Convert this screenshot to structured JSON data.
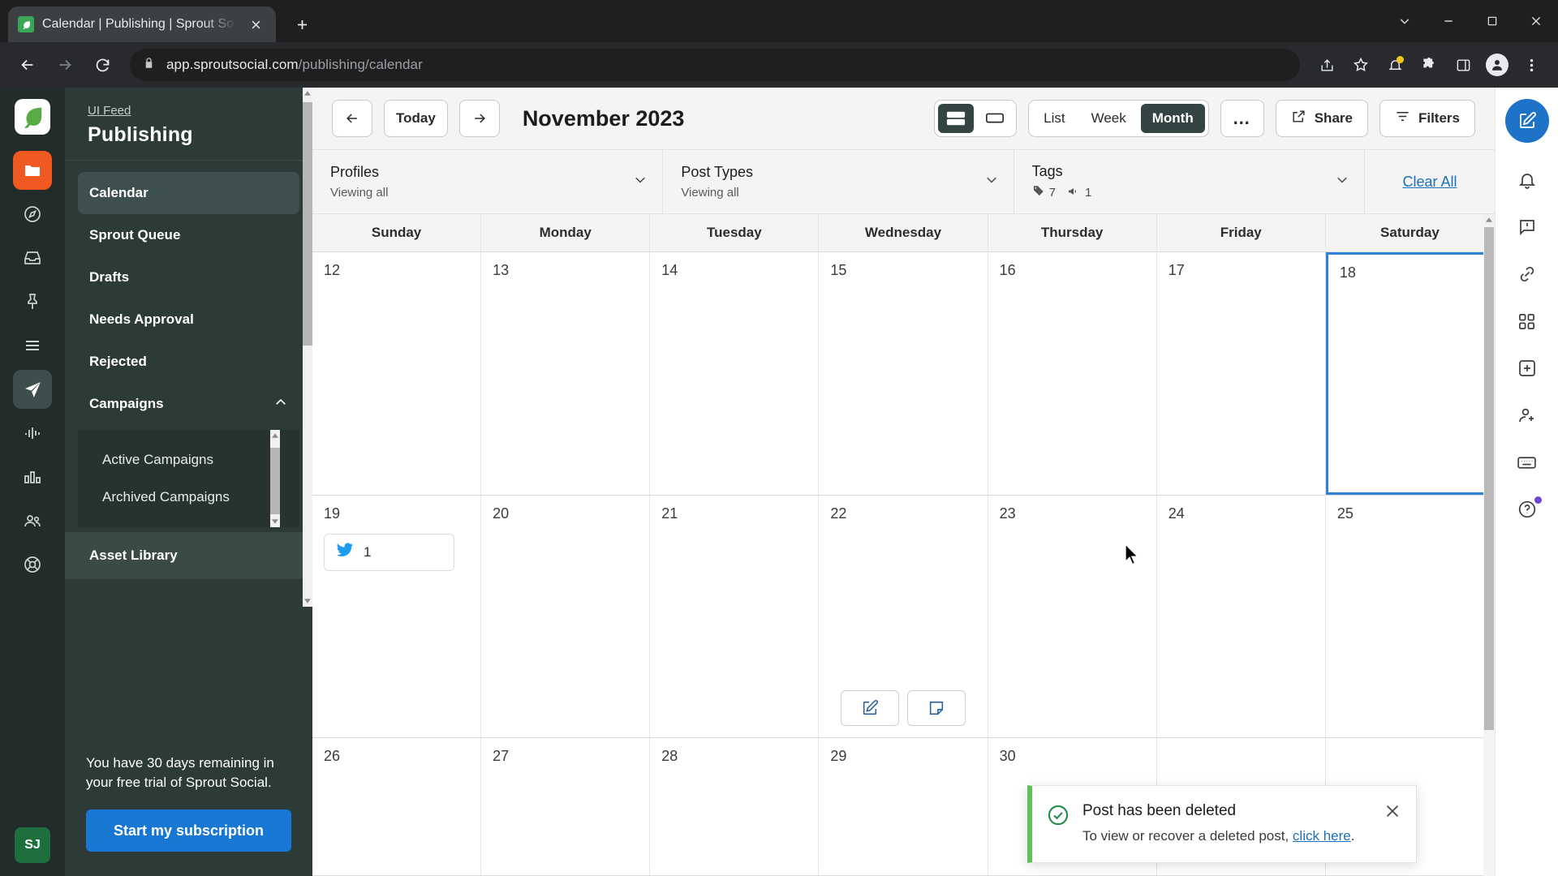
{
  "browser": {
    "tab": {
      "title": "Calendar | Publishing | Sprout So",
      "favicon": "sprout-leaf-icon",
      "close": "close-icon"
    },
    "new_tab": "+",
    "window_controls": {
      "minimize": "minimize-icon",
      "maximize": "maximize-icon",
      "close": "close-icon",
      "chevron": "chevron-down-icon"
    },
    "nav": {
      "back": "back-arrow-icon",
      "forward": "forward-arrow-icon",
      "reload": "reload-icon"
    },
    "url": {
      "lock": "lock-icon",
      "domain": "app.sproutsocial.com",
      "path": "/publishing/calendar"
    },
    "omni_actions": [
      "share-icon",
      "bookmark-star-icon",
      "extension-puzzle-icon",
      "side-panel-icon",
      "profile-avatar-icon",
      "kebab-menu-icon"
    ]
  },
  "rail": {
    "logo": "sprout-logo",
    "items": [
      {
        "name": "folder",
        "icon": "folder-icon",
        "state": "accent"
      },
      {
        "name": "compass",
        "icon": "compass-icon",
        "state": "default"
      },
      {
        "name": "inbox",
        "icon": "inbox-icon",
        "state": "default"
      },
      {
        "name": "pin",
        "icon": "pin-icon",
        "state": "default"
      },
      {
        "name": "list",
        "icon": "list-icon",
        "state": "default"
      },
      {
        "name": "publishing",
        "icon": "paper-plane-icon",
        "state": "active"
      },
      {
        "name": "listening",
        "icon": "waveform-icon",
        "state": "default"
      },
      {
        "name": "reports",
        "icon": "bar-chart-icon",
        "state": "default"
      },
      {
        "name": "people",
        "icon": "people-icon",
        "state": "default"
      },
      {
        "name": "settings",
        "icon": "lifebuoy-icon",
        "state": "default"
      }
    ],
    "avatar_initials": "SJ"
  },
  "sidebar": {
    "breadcrumb": "UI Feed",
    "title": "Publishing",
    "items": [
      {
        "label": "Calendar",
        "selected": true
      },
      {
        "label": "Sprout Queue",
        "selected": false
      },
      {
        "label": "Drafts",
        "selected": false
      },
      {
        "label": "Needs Approval",
        "selected": false
      },
      {
        "label": "Rejected",
        "selected": false
      },
      {
        "label": "Campaigns",
        "selected": false,
        "expanded": true,
        "chevron": "chevron-up-icon"
      }
    ],
    "campaign_children": [
      {
        "label": "Active Campaigns"
      },
      {
        "label": "Archived Campaigns"
      }
    ],
    "asset_library": "Asset Library",
    "trial": {
      "text": "You have 30 days remaining in your free trial of Sprout Social.",
      "cta": "Start my subscription",
      "cta_color": "#1877d2"
    }
  },
  "toolbar": {
    "prev": "left-arrow-icon",
    "today": "Today",
    "next": "right-arrow-icon",
    "month_title": "November 2023",
    "density": [
      {
        "name": "comfortable",
        "icon": "rows-large-icon",
        "active": true
      },
      {
        "name": "compact",
        "icon": "rows-small-icon",
        "active": false
      }
    ],
    "views": [
      {
        "label": "List",
        "active": false
      },
      {
        "label": "Week",
        "active": false
      },
      {
        "label": "Month",
        "active": true
      }
    ],
    "more": "…",
    "share": {
      "label": "Share",
      "icon": "share-external-icon"
    },
    "filters": {
      "label": "Filters",
      "icon": "filter-lines-icon"
    }
  },
  "filters": {
    "profiles": {
      "label": "Profiles",
      "value": "Viewing all",
      "chevron": "chevron-down-icon"
    },
    "post_types": {
      "label": "Post Types",
      "value": "Viewing all",
      "chevron": "chevron-down-icon"
    },
    "tags": {
      "label": "Tags",
      "chips": [
        {
          "icon": "tag-icon",
          "count": "7"
        },
        {
          "icon": "megaphone-icon",
          "count": "1"
        }
      ],
      "chevron": "chevron-down-icon"
    },
    "clear_all": "Clear All"
  },
  "calendar": {
    "day_headers": [
      "Sunday",
      "Monday",
      "Tuesday",
      "Wednesday",
      "Thursday",
      "Friday",
      "Saturday"
    ],
    "today_date": "18",
    "weeks": [
      {
        "days": [
          {
            "num": "12"
          },
          {
            "num": "13"
          },
          {
            "num": "14"
          },
          {
            "num": "15"
          },
          {
            "num": "16"
          },
          {
            "num": "17"
          },
          {
            "num": "18",
            "today": true
          }
        ]
      },
      {
        "days": [
          {
            "num": "19",
            "post": {
              "network": "twitter-icon",
              "count": "1"
            }
          },
          {
            "num": "20"
          },
          {
            "num": "21"
          },
          {
            "num": "22",
            "hover_actions": [
              "compose-post-icon",
              "add-note-icon"
            ]
          },
          {
            "num": "23"
          },
          {
            "num": "24"
          },
          {
            "num": "25"
          }
        ]
      },
      {
        "days": [
          {
            "num": "26"
          },
          {
            "num": "27"
          },
          {
            "num": "28"
          },
          {
            "num": "29"
          },
          {
            "num": "30"
          },
          {
            "num": ""
          },
          {
            "num": ""
          }
        ]
      }
    ]
  },
  "right_rail": {
    "compose": "compose-pencil-icon",
    "items": [
      "bell-icon",
      "feedback-icon",
      "link-icon",
      "grid-apps-icon",
      "add-square-icon",
      "add-user-icon",
      "keyboard-icon",
      "help-circle-icon"
    ]
  },
  "toast": {
    "icon": "check-circle-icon",
    "title": "Post has been deleted",
    "body_prefix": "To view or recover a deleted post, ",
    "link": "click here",
    "body_suffix": ".",
    "close": "close-icon",
    "accent_color": "#5ac45a"
  }
}
